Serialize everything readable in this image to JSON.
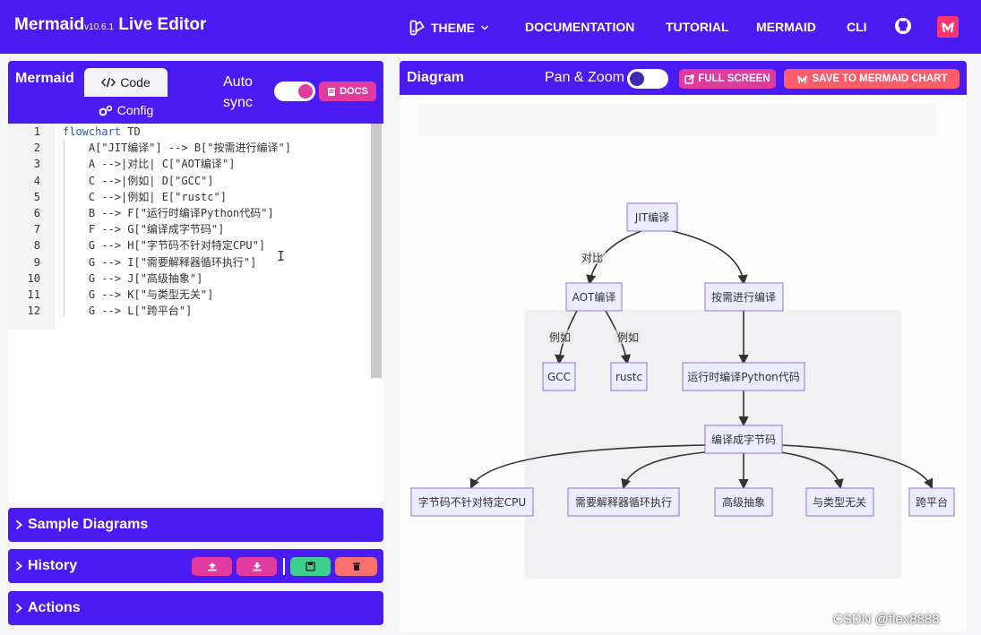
{
  "header": {
    "brand": "Mermaid",
    "version": "v10.6.1",
    "brand_suffix": " Live Editor",
    "nav": {
      "theme": "THEME",
      "documentation": "DOCUMENTATION",
      "tutorial": "TUTORIAL",
      "mermaid": "MERMAID",
      "cli": "CLI"
    },
    "accent": "#4a1bf3"
  },
  "editor_panel": {
    "title": "Mermaid",
    "tab_code": "Code",
    "tab_config": "Config",
    "autosync_line1": "Auto",
    "autosync_line2": "sync",
    "autosync_on": true,
    "docs_label": "DOCS",
    "code_lines": [
      {
        "n": "1",
        "kw": "flowchart",
        "text": " TD"
      },
      {
        "n": "2",
        "kw": "",
        "text": "    A[\"JIT编译\"] --> B[\"按需进行编译\"]"
      },
      {
        "n": "3",
        "kw": "",
        "text": "    A -->|对比| C[\"AOT编译\"]"
      },
      {
        "n": "4",
        "kw": "",
        "text": "    C -->|例如| D[\"GCC\"]"
      },
      {
        "n": "5",
        "kw": "",
        "text": "    C -->|例如| E[\"rustc\"]"
      },
      {
        "n": "6",
        "kw": "",
        "text": "    B --> F[\"运行时编译Python代码\"]"
      },
      {
        "n": "7",
        "kw": "",
        "text": "    F --> G[\"编译成字节码\"]"
      },
      {
        "n": "8",
        "kw": "",
        "text": "    G --> H[\"字节码不针对特定CPU\"]"
      },
      {
        "n": "9",
        "kw": "",
        "text": "    G --> I[\"需要解释器循环执行\"]"
      },
      {
        "n": "10",
        "kw": "",
        "text": "    G --> J[\"高级抽象\"]"
      },
      {
        "n": "11",
        "kw": "",
        "text": "    G --> K[\"与类型无关\"]"
      },
      {
        "n": "12",
        "kw": "",
        "text": "    G --> L[\"跨平台\"]"
      }
    ]
  },
  "accordions": {
    "sample": "Sample Diagrams",
    "history": "History",
    "actions": "Actions"
  },
  "diagram_panel": {
    "title": "Diagram",
    "pan_zoom": "Pan & Zoom",
    "pan_zoom_on": false,
    "full_screen": "FULL SCREEN",
    "save_chart": "SAVE TO MERMAID CHART"
  },
  "diagram": {
    "nodes": {
      "A": "JIT编译",
      "B": "按需进行编译",
      "C": "AOT编译",
      "D": "GCC",
      "E": "rustc",
      "F": "运行时编译Python代码",
      "G": "编译成字节码",
      "H": "字节码不针对特定CPU",
      "I": "需要解释器循环执行",
      "J": "高级抽象",
      "K": "与类型无关",
      "L": "跨平台"
    },
    "edge_labels": {
      "AC": "对比",
      "CD": "例如",
      "CE": "例如"
    },
    "node_fill": "#ececff",
    "node_stroke": "#9370db"
  },
  "watermark": "CSDN @flex8888"
}
